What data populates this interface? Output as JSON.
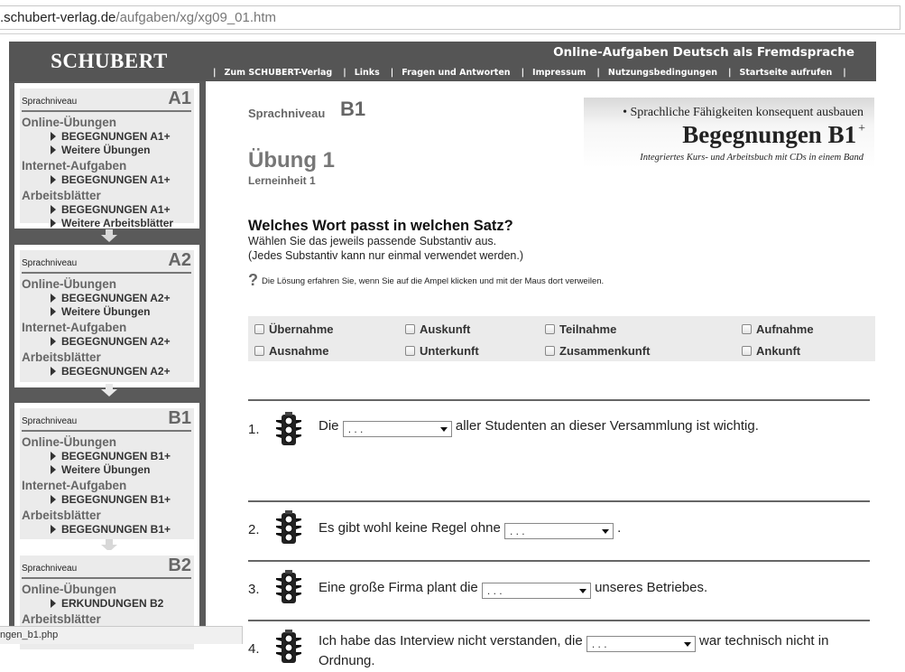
{
  "browser": {
    "url_host": ".schubert-verlag.de",
    "url_path": "/aufgaben/xg/xg09_01.htm",
    "status_text": "ngen_b1.php"
  },
  "header": {
    "brand": "SCHUBERT",
    "tagline": "Online-Aufgaben Deutsch als Fremdsprache",
    "nav": [
      "Zum SCHUBERT-Verlag",
      "Links",
      "Fragen und Antworten",
      "Impressum",
      "Nutzungsbedingungen",
      "Startseite aufrufen"
    ],
    "separator": "|"
  },
  "sidebar": {
    "level_label": "Sprachniveau",
    "levels": [
      {
        "code": "A1",
        "sections": [
          {
            "title": "Online-Übungen",
            "links": [
              "BEGEGNUNGEN A1+",
              "Weitere Übungen"
            ]
          },
          {
            "title": "Internet-Aufgaben",
            "links": [
              "BEGEGNUNGEN A1+"
            ]
          },
          {
            "title": "Arbeitsblätter",
            "links": [
              "BEGEGNUNGEN A1+",
              "Weitere Arbeitsblätter"
            ]
          }
        ]
      },
      {
        "code": "A2",
        "sections": [
          {
            "title": "Online-Übungen",
            "links": [
              "BEGEGNUNGEN A2+",
              "Weitere Übungen"
            ]
          },
          {
            "title": "Internet-Aufgaben",
            "links": [
              "BEGEGNUNGEN A2+"
            ]
          },
          {
            "title": "Arbeitsblätter",
            "links": [
              "BEGEGNUNGEN A2+"
            ]
          }
        ]
      },
      {
        "code": "B1",
        "sections": [
          {
            "title": "Online-Übungen",
            "links": [
              "BEGEGNUNGEN B1+",
              "Weitere Übungen"
            ]
          },
          {
            "title": "Internet-Aufgaben",
            "links": [
              "BEGEGNUNGEN B1+"
            ]
          },
          {
            "title": "Arbeitsblätter",
            "links": [
              "BEGEGNUNGEN B1+"
            ]
          }
        ]
      },
      {
        "code": "B2",
        "sections": [
          {
            "title": "Online-Übungen",
            "links": [
              "ERKUNDUNGEN B2"
            ]
          },
          {
            "title": "Arbeitsblätter",
            "links": []
          }
        ]
      }
    ]
  },
  "main": {
    "level_label": "Sprachniveau",
    "level_code": "B1",
    "title": "Übung 1",
    "subtitle": "Lerneinheit 1",
    "promo": {
      "bullet": "• Sprachliche Fähigkeiten konsequent ausbauen",
      "title": "Begegnungen B1",
      "title_sup": "+",
      "sub": "Integriertes Kurs- und Arbeitsbuch mit CDs in einem Band"
    },
    "task_heading": "Welches Wort passt in welchen Satz?",
    "task_line1": "Wählen Sie das jeweils passende Substantiv aus.",
    "task_line2": "(Jedes Substantiv kann nur einmal verwendet werden.)",
    "hint_icon": "?",
    "hint": "Die Lösung erfahren Sie, wenn Sie auf die Ampel klicken und mit der Maus dort verweilen.",
    "words": [
      "Übernahme",
      "Auskunft",
      "Teilnahme",
      "Aufnahme",
      "Ausnahme",
      "Unterkunft",
      "Zusammenkunft",
      "Ankunft"
    ],
    "select_placeholder": ". . .",
    "items": [
      {
        "num": "1.",
        "before": "Die",
        "after": "aller Studenten an dieser Versammlung ist wichtig."
      },
      {
        "num": "2.",
        "before": "Es gibt wohl keine Regel ohne",
        "after": "."
      },
      {
        "num": "3.",
        "before": "Eine große Firma plant die",
        "after": "unseres Betriebes."
      },
      {
        "num": "4.",
        "before": "Ich habe das Interview nicht verstanden, die",
        "after": "war technisch nicht in Ordnung."
      }
    ]
  },
  "icons": {
    "traffic_light": "traffic-light-icon",
    "checkbox": "checkbox",
    "triangle": "triangle-right-icon",
    "arrow": "arrow-down-icon"
  },
  "colors": {
    "header_bg": "#555555",
    "sidebar_bg": "#5a5a5a",
    "panel_bg": "#ebebeb",
    "heading_grey": "#666666"
  }
}
